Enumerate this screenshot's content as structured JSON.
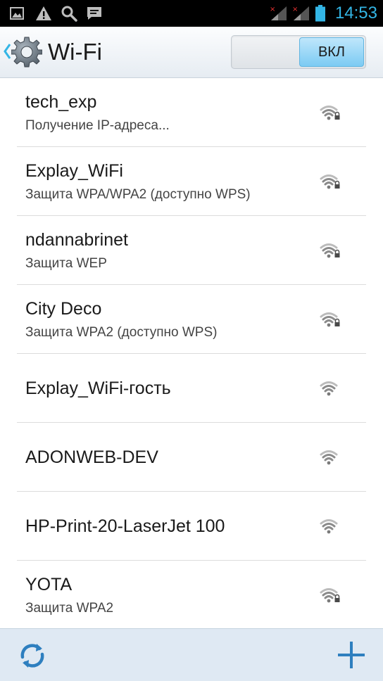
{
  "status_bar": {
    "time": "14:53",
    "icons": [
      "gallery-icon",
      "warning-icon",
      "search-icon",
      "message-icon",
      "signal-sim1-icon",
      "signal-sim2-icon",
      "battery-icon"
    ]
  },
  "action_bar": {
    "title": "Wi-Fi",
    "toggle_label": "ВКЛ",
    "icon": "gear-icon"
  },
  "networks": [
    {
      "name": "tech_exp",
      "status": "Получение IP-адреса...",
      "secured": true
    },
    {
      "name": "Explay_WiFi",
      "status": "Защита WPA/WPA2 (доступно WPS)",
      "secured": true
    },
    {
      "name": "ndannabrinet",
      "status": "Защита WEP",
      "secured": true
    },
    {
      "name": "City Deco",
      "status": "Защита WPA2 (доступно WPS)",
      "secured": true
    },
    {
      "name": "Explay_WiFi-гость",
      "status": "",
      "secured": false
    },
    {
      "name": "ADONWEB-DEV",
      "status": "",
      "secured": false
    },
    {
      "name": "HP-Print-20-LaserJet 100",
      "status": "",
      "secured": false
    },
    {
      "name": "YOTA",
      "status": "Защита WPA2",
      "secured": true
    }
  ],
  "bottom_bar": {
    "icons": [
      "refresh-icon",
      "add-icon"
    ]
  },
  "colors": {
    "accent": "#33b5e5",
    "status_bar": "#000000",
    "bottom_bar": "#dfe9f3"
  }
}
